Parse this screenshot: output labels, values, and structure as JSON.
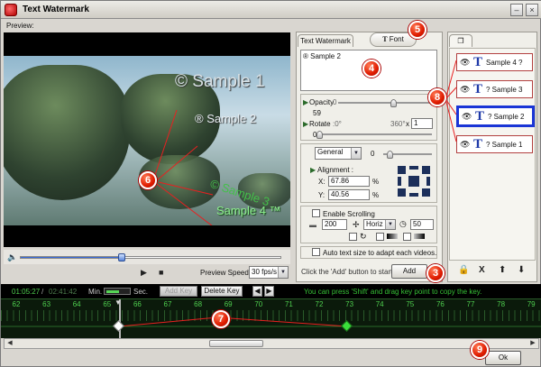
{
  "window": {
    "title": "Text Watermark",
    "preview_label": "Preview:"
  },
  "watermarks_on_video": [
    "© Sample 1",
    "® Sample 2",
    "© Sample 3",
    "Sample 4 ™"
  ],
  "player": {
    "progress_percent": 39,
    "speed_label": "Preview Speed:",
    "speed_value": "30 fps/s"
  },
  "editor": {
    "tab_watermark": "Text Watermark",
    "tab_font": "Font",
    "text_value": "® Sample 2",
    "opacity_label": "Opacity",
    "opacity_min": "0",
    "opacity_value": "59",
    "opacity_percent": 59,
    "rotate_label": "Rotate",
    "rotate_min": ":0°",
    "rotate_max": "360°",
    "rotate_multiplier": "x",
    "rotate_factor": "1",
    "rotate_value": "0",
    "rotate_percent": 0,
    "preset_value": "General",
    "preset_number": "0",
    "alignment_label": "Alignment :",
    "x_label": "X:",
    "x_value": "67.86",
    "y_label": "Y:",
    "y_value": "40.56",
    "percent_sign": "%",
    "enable_scrolling": "Enable Scrolling",
    "scroll_speed": "200",
    "scroll_direction": "Horiz",
    "scroll_count": "50",
    "auto_text_size": "Auto text size to adapt each videos.",
    "add_hint": "Click the 'Add' button to start ->",
    "add_label": "Add"
  },
  "list": {
    "items": [
      {
        "label": "Sample 4 ?",
        "selected": false
      },
      {
        "label": "? Sample 3",
        "selected": false
      },
      {
        "label": "? Sample 2",
        "selected": true
      },
      {
        "label": "? Sample 1",
        "selected": false
      }
    ]
  },
  "timeline": {
    "current_time": "01:05:27",
    "separator": "/",
    "total_time": "02:41:42",
    "min_label": "Min.",
    "sec_label": "Sec.",
    "add_key_label": "Add Key",
    "delete_key_label": "Delete Key",
    "hint": "You can press 'Shift' and drag key point to copy the key.",
    "tick_labels": [
      "62",
      "63",
      "64",
      "65",
      "66",
      "67",
      "68",
      "69",
      "70",
      "71",
      "72",
      "73",
      "74",
      "75",
      "76",
      "77",
      "78",
      "79"
    ]
  },
  "footer": {
    "ok_label": "Ok"
  },
  "callouts": [
    "4",
    "5",
    "6",
    "7",
    "8",
    "9",
    "3"
  ],
  "colors": {
    "accent_blue": "#1a35d6",
    "timeline_green": "#4fcf4f",
    "callout_red": "#e01b00",
    "hint_green": "#36c036"
  }
}
